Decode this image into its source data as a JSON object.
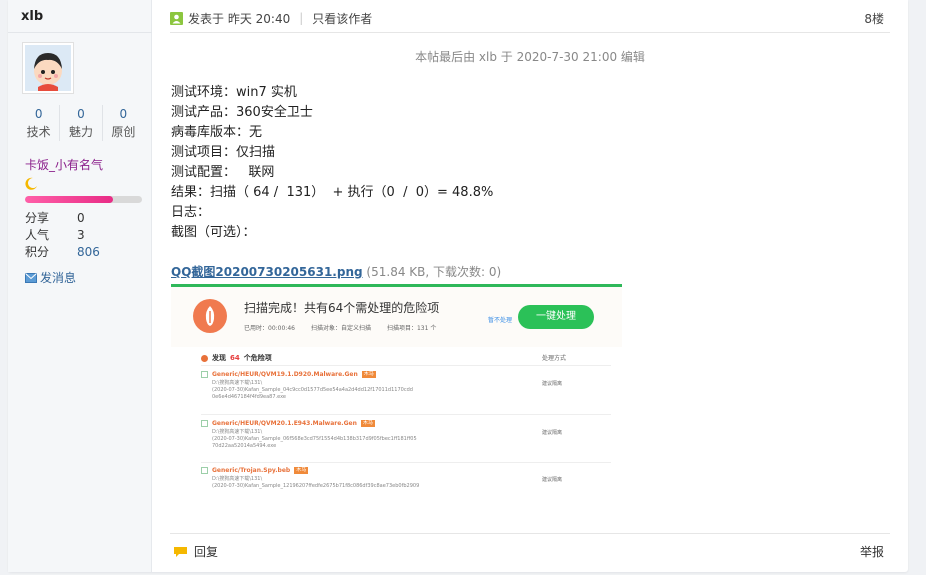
{
  "user": {
    "name": "xlb",
    "stats": [
      {
        "value": "0",
        "label": "技术"
      },
      {
        "value": "0",
        "label": "魅力"
      },
      {
        "value": "0",
        "label": "原创"
      }
    ],
    "group": "卡饭_小有名气",
    "level_progress_percent": 75,
    "info": [
      {
        "key": "分享",
        "value": "0"
      },
      {
        "key": "人气",
        "value": "3"
      },
      {
        "key": "积分",
        "value": "806"
      }
    ],
    "send_message": "发消息"
  },
  "post": {
    "posted": "发表于 昨天 20:40",
    "only_author": "只看该作者",
    "floor": "8楼",
    "edited": "本帖最后由 xlb 于 2020-7-30 21:00 编辑",
    "lines": [
      "测试环境：win7  实机",
      "测试产品：360安全卫士",
      "病毒库版本：无",
      "测试项目：仅扫描",
      "测试配置：   联网",
      "结果：扫描（ 64 /  131）  + 执行（0  /  0）= 48.8%",
      "日志：",
      "截图（可选）："
    ],
    "attachment_name": "QQ截图20200730205631.png",
    "attachment_meta": "(51.84 KB, 下载次数: 0)",
    "reply": "回复",
    "report": "举报"
  },
  "screenshot": {
    "title": "扫描完成！共有64个需处理的危险项",
    "sub": [
      "已用时：00:00:46",
      "扫描对象：自定义扫描",
      "扫描项目：131 个"
    ],
    "ignore": "暂不处理",
    "button": "一键处理",
    "section_prefix": "发现",
    "section_count": "64",
    "section_suffix": "个危险项",
    "action_col": "处理方式",
    "items": [
      {
        "name": "Generic/HEUR/QVM19.1.D920.Malware.Gen",
        "tag": "木马",
        "path1": "D:\\搜狗高速下载\\131\\",
        "path2": "(2020-07-30)Kafan_Sample_04c9cc0d1577d5ee54a4a2d4dd12f17011d1170cdd",
        "path3": "0e6e4d467184f4fd9ea87.exe",
        "action": "建议隔离"
      },
      {
        "name": "Generic/HEUR/QVM20.1.E943.Malware.Gen",
        "tag": "木马",
        "path1": "D:\\搜狗高速下载\\131\\",
        "path2": "(2020-07-30)Kafan_Sample_06f568e3cd75f1554d4b138b317d9f05fbec1ff181ff05",
        "path3": "70d22aa52014a5494.exe",
        "action": "建议隔离"
      },
      {
        "name": "Generic/Trojan.Spy.beb",
        "tag": "木马",
        "path1": "D:\\搜狗高速下载\\131\\",
        "path2": "(2020-07-30)Kafan_Sample_12196207ffedfe2675b71f8c086df39c8ae73eb0fb2909",
        "path3": "",
        "action": "建议隔离"
      }
    ]
  },
  "colors": {
    "link": "#336699",
    "accent_green": "#2bc158",
    "group_purple": "#8a1e8a",
    "bar_pink": "#e82c86"
  }
}
